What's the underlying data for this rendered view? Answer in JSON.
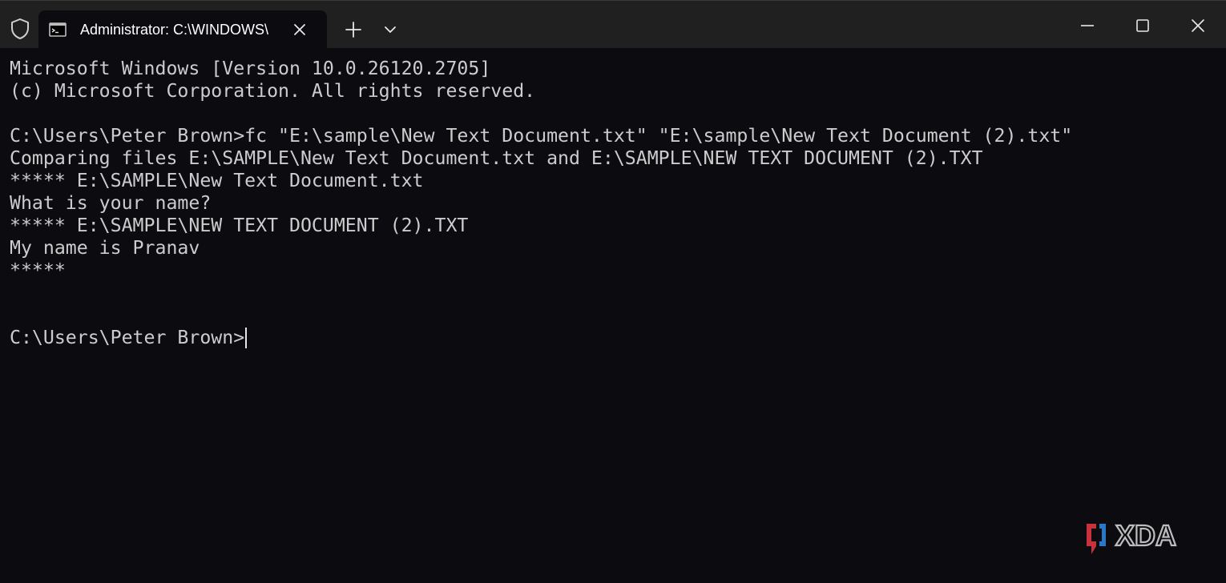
{
  "window": {
    "tab_title": "Administrator: C:\\WINDOWS\\",
    "icons": {
      "shield": "shield-icon",
      "tab": "terminal-icon",
      "tab_close": "close-icon",
      "new_tab": "plus-icon",
      "dropdown": "chevron-down-icon",
      "minimize": "minimize-icon",
      "maximize": "maximize-icon",
      "close": "close-icon"
    }
  },
  "terminal": {
    "lines": [
      "Microsoft Windows [Version 10.0.26120.2705]",
      "(c) Microsoft Corporation. All rights reserved.",
      "",
      "C:\\Users\\Peter Brown>fc \"E:\\sample\\New Text Document.txt\" \"E:\\sample\\New Text Document (2).txt\"",
      "Comparing files E:\\SAMPLE\\New Text Document.txt and E:\\SAMPLE\\NEW TEXT DOCUMENT (2).TXT",
      "***** E:\\SAMPLE\\New Text Document.txt",
      "What is your name?",
      "***** E:\\SAMPLE\\NEW TEXT DOCUMENT (2).TXT",
      "My name is Pranav",
      "*****",
      "",
      ""
    ],
    "prompt": "C:\\Users\\Peter Brown>"
  },
  "watermark": {
    "text": "XDA"
  },
  "colors": {
    "titlebar_bg": "#202020",
    "terminal_bg": "#0c0b10",
    "terminal_text": "#cccccc",
    "watermark_red": "#c8323c",
    "watermark_blue": "#2a78c8"
  }
}
